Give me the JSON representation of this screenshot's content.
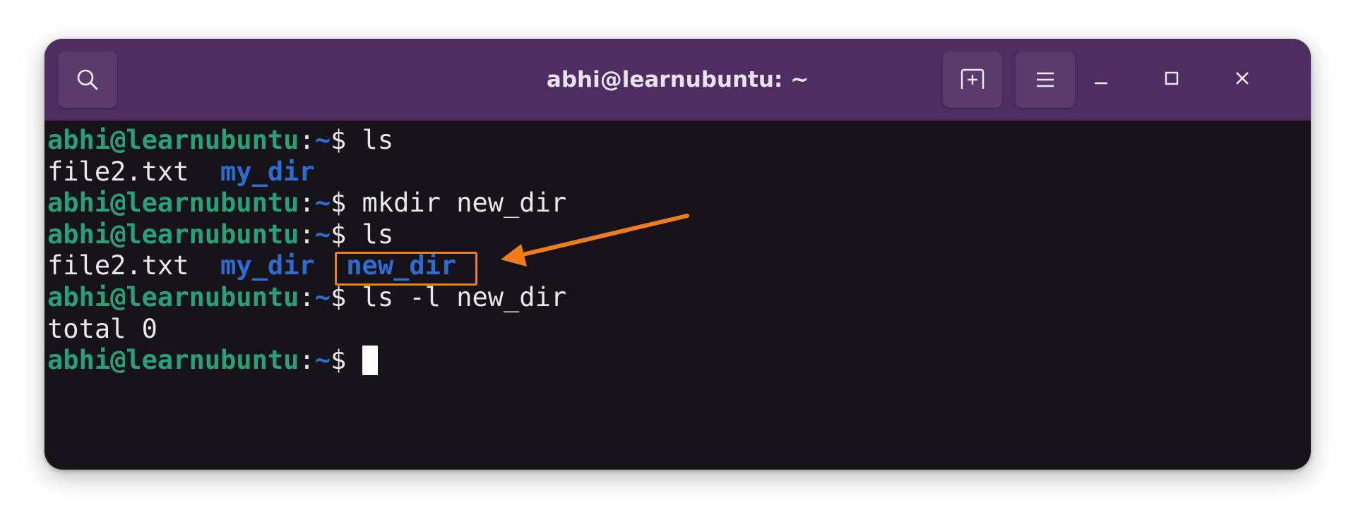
{
  "window": {
    "title": "abhi@learnubuntu: ~",
    "accent_color": "#4e2e60",
    "background_color": "#171419"
  },
  "header": {
    "search_icon": "search-icon",
    "new_tab_icon": "new-tab-icon",
    "menu_icon": "hamburger-menu-icon",
    "minimize_icon": "minimize-icon",
    "maximize_icon": "maximize-icon",
    "close_icon": "close-icon"
  },
  "terminal": {
    "prompt_user": "abhi@learnubuntu",
    "prompt_colon": ":",
    "prompt_path": "~",
    "prompt_symbol": "$ ",
    "lines": [
      {
        "type": "command",
        "text": "ls"
      },
      {
        "type": "output",
        "file": "file2.txt",
        "dirs": [
          "my_dir"
        ]
      },
      {
        "type": "command",
        "text": "mkdir new_dir"
      },
      {
        "type": "command",
        "text": "ls"
      },
      {
        "type": "output",
        "file": "file2.txt",
        "dirs": [
          "my_dir",
          "new_dir"
        ]
      },
      {
        "type": "command",
        "text": "ls -l new_dir"
      },
      {
        "type": "plain",
        "text": "total 0"
      },
      {
        "type": "prompt",
        "text": ""
      }
    ],
    "user_color": "#28a178",
    "dir_color": "#2c6dd4"
  },
  "annotation": {
    "highlighted_text": "new_dir",
    "color": "#f07d1a"
  }
}
